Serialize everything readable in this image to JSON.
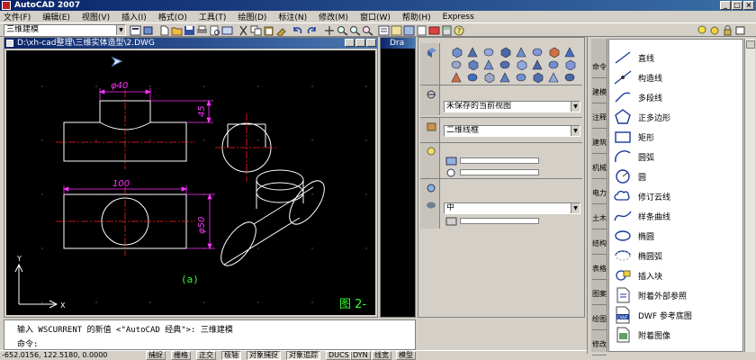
{
  "app": {
    "title": "AutoCAD 2007",
    "window_buttons": [
      "_",
      "□",
      "×"
    ]
  },
  "menu": [
    "文件(F)",
    "编辑(E)",
    "视图(V)",
    "插入(I)",
    "格式(O)",
    "工具(T)",
    "绘图(D)",
    "标注(N)",
    "修改(M)",
    "窗口(W)",
    "帮助(H)",
    "Express"
  ],
  "toolbar": {
    "workspace": "三维建模"
  },
  "drawing": {
    "title": "D:\\xh-cad整理\\三维实体造型\\2.DWG",
    "dim_top": "φ40",
    "dim_right_top": "45",
    "dim_bottom": "100",
    "dim_right_bottom": "φ50",
    "caption": "(a)",
    "figure_label": "图 2-",
    "ucs_x": "X",
    "ucs_y": "Y"
  },
  "drawing2": {
    "title": "Dra"
  },
  "dashboard": {
    "view_select": "未保存的当前视图",
    "visual_style_select": "二维线框",
    "material_select": "中"
  },
  "palette": {
    "tabs": [
      "命令",
      "建模",
      "注释",
      "建筑",
      "机械",
      "电力",
      "土木",
      "结构",
      "表格",
      "图案",
      "绘图",
      "修改"
    ],
    "items": [
      "直线",
      "构造线",
      "多段线",
      "正多边形",
      "矩形",
      "圆弧",
      "圆",
      "修订云线",
      "样条曲线",
      "椭圆",
      "椭圆弧",
      "插入块",
      "附着外部参照",
      "DWF 参考底图",
      "附着图像"
    ]
  },
  "command": {
    "history": "输入 WSCURRENT 的新值 <\"AutoCAD 经典\">: 三维建模",
    "prompt": "命令:"
  },
  "status": {
    "coords": "-652.0156, 122.5180, 0.0000",
    "buttons": [
      "捕捉",
      "栅格",
      "正交",
      "极轴",
      "对象捕捉",
      "对象追踪",
      "DUCS",
      "DYN",
      "线宽",
      "模型"
    ]
  },
  "colors": {
    "canvas": "#000000",
    "geometry": "#ffffff",
    "centerline": "#ff2020",
    "dimension": "#ff33ff",
    "caption": "#33ff33"
  }
}
